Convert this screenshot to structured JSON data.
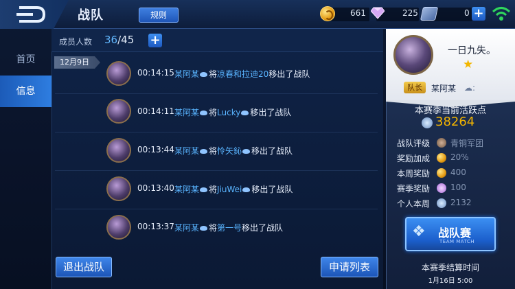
{
  "header": {
    "title": "战队",
    "rules_label": "规则",
    "currency_coins": "661",
    "currency_gems": "225",
    "currency_vouchers": "0"
  },
  "nav": {
    "items": [
      {
        "label": "首页",
        "active": false
      },
      {
        "label": "信息",
        "active": true
      }
    ]
  },
  "members": {
    "label": "成员人数",
    "current": "36",
    "max": "/45"
  },
  "log": {
    "date": "12月9日",
    "entries": [
      {
        "time": "00:14:15",
        "actor": "某阿某",
        "verb": "将",
        "target": "凉春和拉迪20",
        "action": "移出了战队"
      },
      {
        "time": "00:14:11",
        "actor": "某阿某",
        "verb": "将",
        "target": "Lucky",
        "action": "移出了战队"
      },
      {
        "time": "00:13:44",
        "actor": "某阿某",
        "verb": "将",
        "target": "怜矢鈊",
        "action": "移出了战队"
      },
      {
        "time": "00:13:40",
        "actor": "某阿某",
        "verb": "将",
        "target": "JiuWei",
        "action": "移出了战队"
      },
      {
        "time": "00:13:37",
        "actor": "某阿某",
        "verb": "将",
        "target": "第一号",
        "action": "移出了战队"
      }
    ]
  },
  "buttons": {
    "leave": "退出战队",
    "applications": "申请列表"
  },
  "team": {
    "name": "一日九失。",
    "captain_badge": "队长",
    "captain_name": "某阿某",
    "season_active_label": "本赛季当前活跃点",
    "season_active_value": "38264",
    "stats": [
      {
        "label": "战队评级",
        "icon": "rank-icon",
        "value": "青铜军团"
      },
      {
        "label": "奖励加成",
        "icon": "coin-icon",
        "value": "20%"
      },
      {
        "label": "本周奖励",
        "icon": "coin-icon",
        "value": "400"
      },
      {
        "label": "赛季奖励",
        "icon": "gem-icon",
        "value": "100"
      },
      {
        "label": "个人本周",
        "icon": "points-icon",
        "value": "2132"
      }
    ],
    "war_button": "战队赛",
    "war_button_sub": "TEAM MATCH",
    "season_end_label": "本赛季结算时间",
    "season_end_date": "1月16日 5:00"
  },
  "colors": {
    "accent_blue": "#2f7de0",
    "highlight_name": "#59b4ff",
    "gold": "#f2b400"
  }
}
